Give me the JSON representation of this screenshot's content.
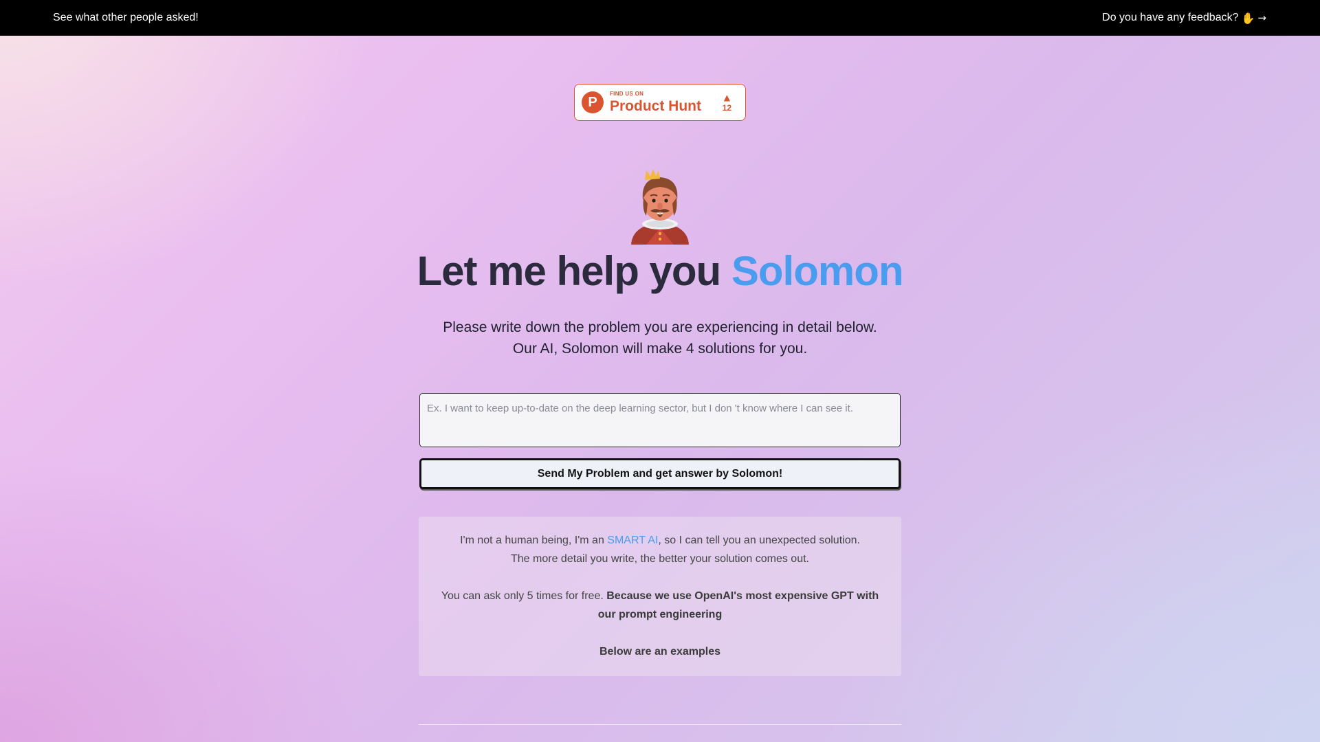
{
  "nav": {
    "left_link": "See what other people asked!",
    "feedback_text": "Do you have any feedback?",
    "feedback_hand": "✋",
    "feedback_arrow": "→"
  },
  "product_hunt": {
    "small_label": "FIND US ON",
    "big_label": "Product Hunt",
    "logo_letter": "P",
    "upvote_icon": "▲",
    "votes": "12",
    "brand_color": "#da552f"
  },
  "hero": {
    "title_prefix": "Let me help you",
    "title_accent": "Solomon",
    "accent_color": "#4a9cee",
    "subtitle_line1": "Please write down the problem you are experiencing in detail below.",
    "subtitle_line2": "Our AI, Solomon will make 4 solutions for you."
  },
  "form": {
    "placeholder": "Ex. I want to keep up-to-date on the deep learning sector, but I don 't know where I can see it.",
    "value": "",
    "submit_label": "Send My Problem and get answer by Solomon!"
  },
  "info": {
    "line1_pre": "I'm not a human being, I'm an ",
    "line1_link": "SMART AI",
    "line1_post": ", so I can tell you an unexpected solution.",
    "line2": "The more detail you write, the better your solution comes out.",
    "limit_pre": "You can ask only 5 times for free. ",
    "limit_bold": "Because we use OpenAI's most expensive GPT with our prompt engineering",
    "examples": "Below are an examples"
  }
}
